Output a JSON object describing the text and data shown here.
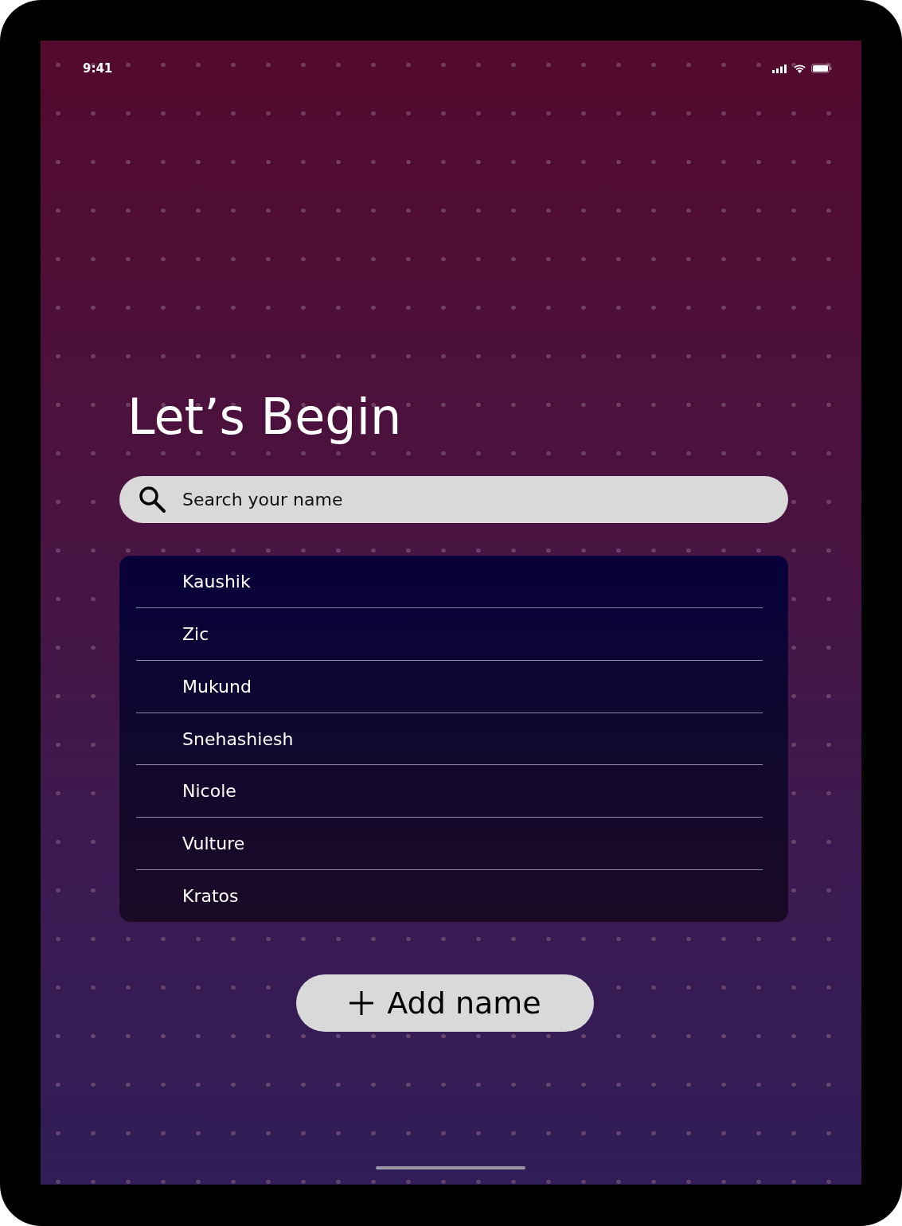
{
  "status_bar": {
    "time": "9:41"
  },
  "title": "Let’s Begin",
  "search": {
    "placeholder": "Search your name"
  },
  "names": [
    {
      "label": "Kaushik"
    },
    {
      "label": "Zic"
    },
    {
      "label": "Mukund"
    },
    {
      "label": "Snehashiesh"
    },
    {
      "label": "Nicole"
    },
    {
      "label": "Vulture"
    },
    {
      "label": "Kratos"
    }
  ],
  "add_button": {
    "label": "Add name"
  }
}
